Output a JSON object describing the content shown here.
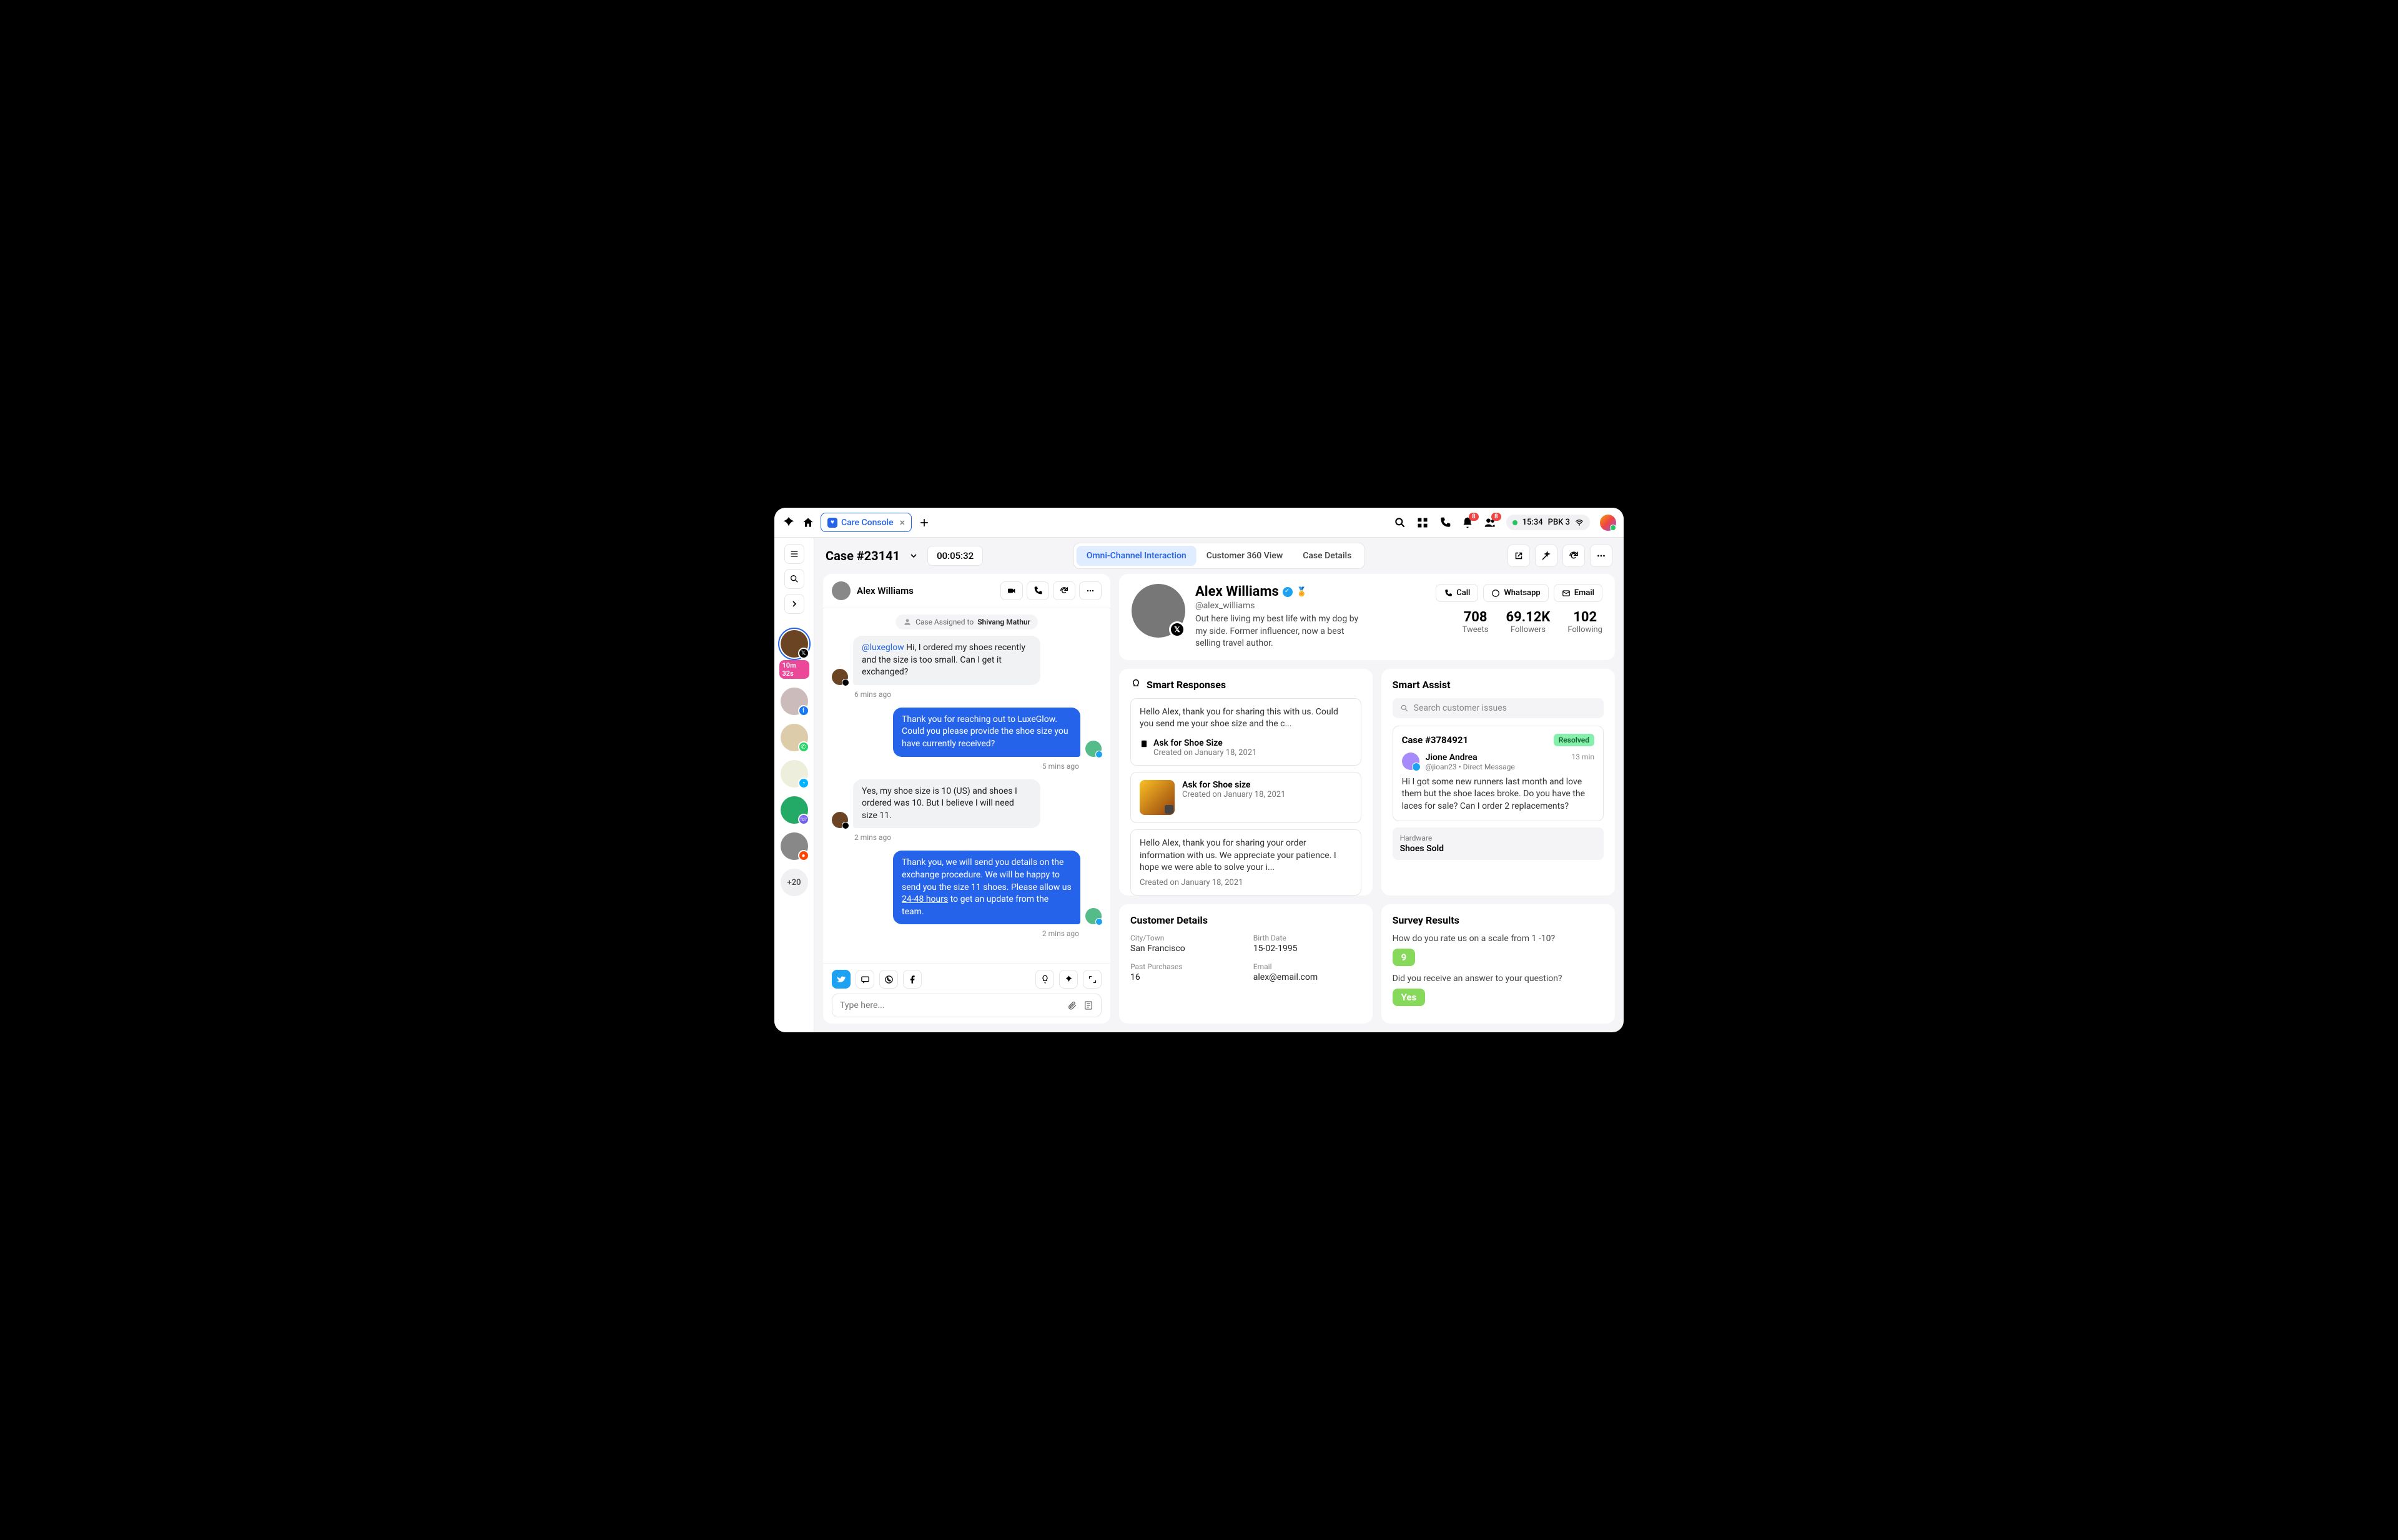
{
  "topbar": {
    "tab_label": "Care Console",
    "time": "15:34",
    "workspace": "PBK 3",
    "notif_count": "8",
    "people_count": "8"
  },
  "header": {
    "case_title": "Case #23141",
    "timer": "00:05:32",
    "tabs": [
      "Omni-Channel Interaction",
      "Customer 360 View",
      "Case Details"
    ]
  },
  "rail": {
    "active_timer": "10m 32s",
    "more_count": "+20"
  },
  "chat": {
    "name": "Alex Williams",
    "assigned_prefix": "Case Assigned to ",
    "assigned_to": "Shivang Mathur",
    "messages": [
      {
        "dir": "in",
        "mention": "@luxeglow",
        "text": " Hi, I ordered my shoes recently and the size is too small. Can I get it exchanged?",
        "time": "6 mins ago"
      },
      {
        "dir": "out",
        "text": "Thank you for reaching out to LuxeGlow. Could you please provide the shoe size you have currently received?",
        "time": "5 mins ago"
      },
      {
        "dir": "in",
        "text": "Yes, my shoe size is 10 (US) and shoes I ordered was 10. But I believe I will need size 11.",
        "time": "2 mins ago"
      },
      {
        "dir": "out",
        "text_a": "Thank you, we will send you details on the exchange procedure. We will be happy to send you the size 11 shoes. Please allow us ",
        "underline": "24-48 hours",
        "text_b": " to get an update from the team.",
        "time": "2 mins ago"
      }
    ],
    "placeholder": "Type here..."
  },
  "profile": {
    "name": "Alex Williams",
    "handle": "@alex_williams",
    "bio": "Out here living my best life with my dog by my side. Former influencer, now a best selling travel author.",
    "actions": {
      "call": "Call",
      "whatsapp": "Whatsapp",
      "email": "Email"
    },
    "stats": [
      {
        "value": "708",
        "label": "Tweets"
      },
      {
        "value": "69.12K",
        "label": "Followers"
      },
      {
        "value": "102",
        "label": "Following"
      }
    ]
  },
  "smart_responses": {
    "title": "Smart Responses",
    "items": [
      {
        "preview": "Hello Alex, thank you for sharing this with us. Could you send me your shoe size and the c...",
        "title": "Ask for Shoe Size",
        "created": "Created on January 18, 2021"
      },
      {
        "title": "Ask for Shoe size",
        "created": "Created on January 18, 2021"
      },
      {
        "preview": "Hello Alex, thank you for sharing your order information with us. We appreciate your patience. I hope we were able to solve your i...",
        "created": "Created on January 18, 2021"
      }
    ]
  },
  "smart_assist": {
    "title": "Smart Assist",
    "search_placeholder": "Search customer issues",
    "case_id": "Case #3784921",
    "status": "Resolved",
    "user_name": "Jione Andrea",
    "user_handle": "@jioan23 • Direct Message",
    "time": "13 min",
    "body": "Hi I got some new runners last month and love them but the shoe laces broke. Do you have the laces for sale? Can I order 2 replacements?",
    "tag_label": "Hardware",
    "tag_value": "Shoes Sold"
  },
  "customer_details": {
    "title": "Customer Details",
    "fields": [
      {
        "label": "City/Town",
        "value": "San Francisco"
      },
      {
        "label": "Birth Date",
        "value": "15-02-1995"
      },
      {
        "label": "Past Purchases",
        "value": "16"
      },
      {
        "label": "Email",
        "value": "alex@email.com"
      }
    ]
  },
  "survey": {
    "title": "Survey Results",
    "q1": "How do you rate us on a scale from 1 -10?",
    "score": "9",
    "q2": "Did you receive an answer to your question?",
    "answer": "Yes"
  }
}
